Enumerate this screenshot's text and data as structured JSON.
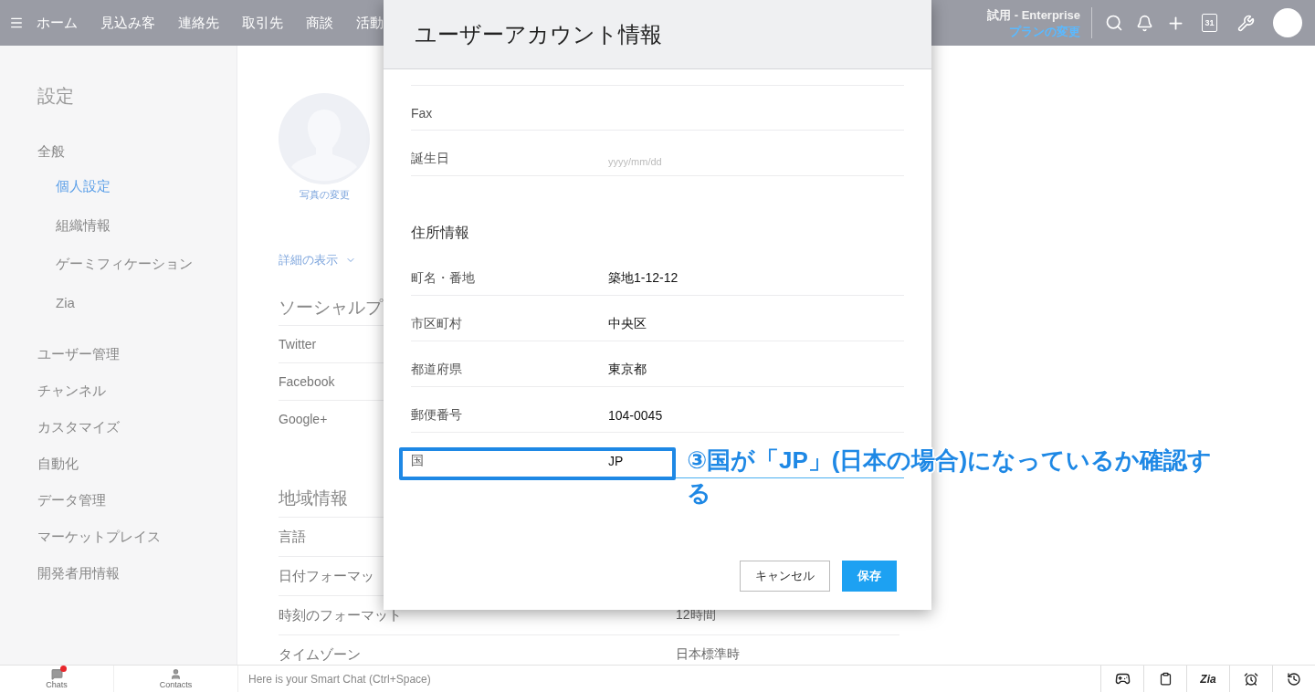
{
  "top_bar": {
    "nav": [
      "ホーム",
      "見込み客",
      "連絡先",
      "取引先",
      "商談",
      "活動"
    ],
    "plan": "試用 - Enterprise",
    "plan_link": "プランの変更",
    "calendar_day": "31"
  },
  "sidebar": {
    "title": "設定",
    "groups": [
      {
        "label": "全般",
        "children": [
          {
            "label": "個人設定",
            "selected": true
          },
          {
            "label": "組織情報",
            "selected": false
          },
          {
            "label": "ゲーミフィケーション",
            "selected": false
          },
          {
            "label": "Zia",
            "selected": false
          }
        ]
      },
      {
        "label": "ユーザー管理"
      },
      {
        "label": "チャンネル"
      },
      {
        "label": "カスタマイズ"
      },
      {
        "label": "自動化"
      },
      {
        "label": "データ管理"
      },
      {
        "label": "マーケットプレイス"
      },
      {
        "label": "開発者用情報"
      }
    ]
  },
  "profile": {
    "photo_link": "写真の変更",
    "details_link": "詳細の表示",
    "social_title": "ソーシャルプ",
    "social": [
      "Twitter",
      "Facebook",
      "Google+"
    ],
    "region_title": "地域情報",
    "region_rows": [
      {
        "label": "言語"
      },
      {
        "label": "日付フォーマッ"
      },
      {
        "label": "時刻のフォーマット",
        "value": "12時間"
      },
      {
        "label": "タイムゾーン",
        "value": "日本標準時"
      }
    ]
  },
  "dialog": {
    "title": "ユーザーアカウント情報",
    "rows": [
      {
        "label": "Fax"
      },
      {
        "label": "誕生日",
        "placeholder": "yyyy/mm/dd"
      }
    ],
    "address_title": "住所情報",
    "address_rows": [
      {
        "label": "町名・番地",
        "value": "築地1-12-12",
        "focused": false,
        "highlighted": false
      },
      {
        "label": "市区町村",
        "value": "中央区",
        "focused": false,
        "highlighted": false
      },
      {
        "label": "都道府県",
        "value": "東京都",
        "focused": false,
        "highlighted": false
      },
      {
        "label": "郵便番号",
        "value": "104-0045",
        "focused": false,
        "highlighted": false
      },
      {
        "label": "国",
        "value": "JP",
        "focused": true,
        "highlighted": true
      }
    ],
    "buttons": [
      {
        "label": "キャンセル",
        "kind": "secondary"
      },
      {
        "label": "保存",
        "kind": "primary"
      }
    ]
  },
  "annotation": {
    "text": "③国が「JP」(日本の場合)になっているか確認する"
  },
  "bottom_bar": {
    "chats": {
      "label": "Chats",
      "unread": true
    },
    "contacts": "Contacts",
    "chat_placeholder": "Here is your Smart Chat (Ctrl+Space)",
    "zia": "Zia"
  }
}
